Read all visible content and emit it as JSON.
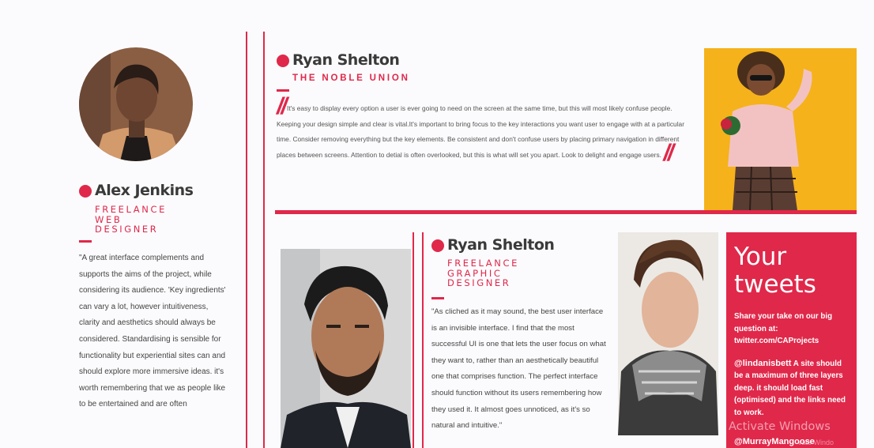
{
  "left_profile": {
    "name": "Alex Jenkins",
    "role": "Freelance Web Designer",
    "quote": "\"A great interface complements and supports the aims of the project, while considering its audience. 'Key ingredients' can vary a lot, however intuitiveness, clarity and aesthetics should always be considered. Standardising is sensible for functionality but experiential sites can and should explore more immersive ideas. it's worth remembering that we as people like to be entertained and are often"
  },
  "top_card": {
    "name": "Ryan Shelton",
    "company": "THE NOBLE UNION",
    "quote": "It's easy to display every option a user is ever going to need on the screen at the same time, but this will most likely confuse people. Keeping your design simple and clear is vital.It's important to bring focus to the key interactions you want user to engage with at a particular time. Consider removing everything but the key elements. Be consistent and don't confuse users by placing primary navigation in different places between screens. Attention to detial is often overlooked, but this is what will set you apart. Look to delight and engage users."
  },
  "middle_card": {
    "name": "Ryan Shelton",
    "role": "Freelance Graphic Designer",
    "quote": "\"As cliched as it may sound, the best user interface is an invisible interface. I find that the most successful UI is one that lets the user focus on what they want to, rather than an aesthetically beautiful one that comprises function. The perfect interface should function without its users remembering how they used it. It almost goes unnoticed, as it's so natural and intuitive.\""
  },
  "tweets": {
    "title": "Your tweets",
    "intro": "Share your take on our big question at: twitter.com/CAProjects",
    "tweet1_handle": "@lindanisbett",
    "tweet1_text": " A site should be a maximum of three layers deep. it should load fast (optimised) and the links need to work.",
    "tweet2_handle": "@MurrayMangoose"
  },
  "watermark": {
    "line1": "Activate Windows",
    "line2": "vate Windo"
  },
  "colors": {
    "accent": "#e0284a",
    "top_photo_bg": "#f5b21b"
  }
}
